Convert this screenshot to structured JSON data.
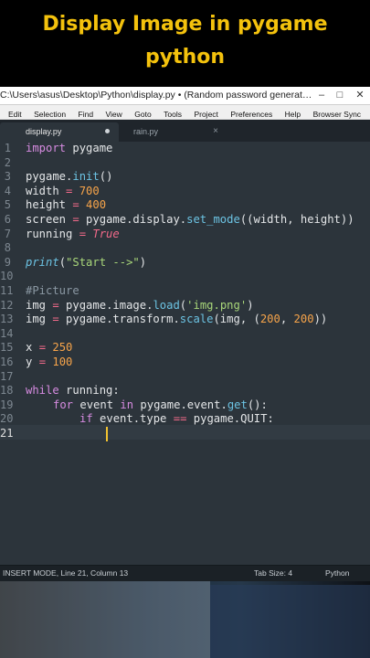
{
  "banner": {
    "line1": "Display Image in pygame",
    "line2": "python"
  },
  "window": {
    "title": "C:\\Users\\asus\\Desktop\\Python\\display.py • (Random password generat…",
    "minimize": "–",
    "maximize": "□",
    "close": "✕"
  },
  "menu": [
    "Edit",
    "Selection",
    "Find",
    "View",
    "Goto",
    "Tools",
    "Project",
    "Preferences",
    "Help",
    "Browser Sync"
  ],
  "tabs": [
    {
      "label": "display.py",
      "active": true,
      "modified": true
    },
    {
      "label": "rain.py",
      "active": false,
      "close": "×"
    }
  ],
  "line_numbers": [
    "1",
    "2",
    "3",
    "4",
    "5",
    "6",
    "7",
    "8",
    "9",
    "10",
    "11",
    "12",
    "13",
    "14",
    "15",
    "16",
    "17",
    "18",
    "19",
    "20",
    "21"
  ],
  "code": {
    "l1": {
      "kw": "import",
      "rest": " pygame"
    },
    "l3": {
      "a": "pygame.",
      "fn": "init",
      "b": "()"
    },
    "l4": {
      "a": "width ",
      "op": "=",
      "num": " 700"
    },
    "l5": {
      "a": "height ",
      "op": "=",
      "num": " 400"
    },
    "l6": {
      "a": "screen ",
      "op": "=",
      "b": " pygame.display.",
      "fn": "set_mode",
      "c": "((width, height))"
    },
    "l7": {
      "a": "running ",
      "op": "=",
      "bool": " True"
    },
    "l9": {
      "fn": "print",
      "a": "(",
      "str": "\"Start -->\"",
      "b": ")"
    },
    "l11": {
      "cmt": "#Picture"
    },
    "l12": {
      "a": "img ",
      "op": "=",
      "b": " pygame.image.",
      "fn": "load",
      "c": "(",
      "str": "'img.png'",
      "d": ")"
    },
    "l13": {
      "a": "img ",
      "op": "=",
      "b": " pygame.transform.",
      "fn": "scale",
      "c": "(img, (",
      "n1": "200",
      "d": ", ",
      "n2": "200",
      "e": "))"
    },
    "l15": {
      "a": "x ",
      "op": "=",
      "num": " 250"
    },
    "l16": {
      "a": "y ",
      "op": "=",
      "num": " 100"
    },
    "l18": {
      "kw": "while",
      "rest": " running:"
    },
    "l19": {
      "kw1": "for",
      "a": " event ",
      "kw2": "in",
      "b": " pygame.event.",
      "fn": "get",
      "c": "():"
    },
    "l20": {
      "kw": "if",
      "a": " event.type ",
      "op": "==",
      "b": " pygame.QUIT:"
    }
  },
  "status": {
    "mode": "INSERT MODE, Line 21, Column 13",
    "tab_size": "Tab Size: 4",
    "language": "Python"
  }
}
